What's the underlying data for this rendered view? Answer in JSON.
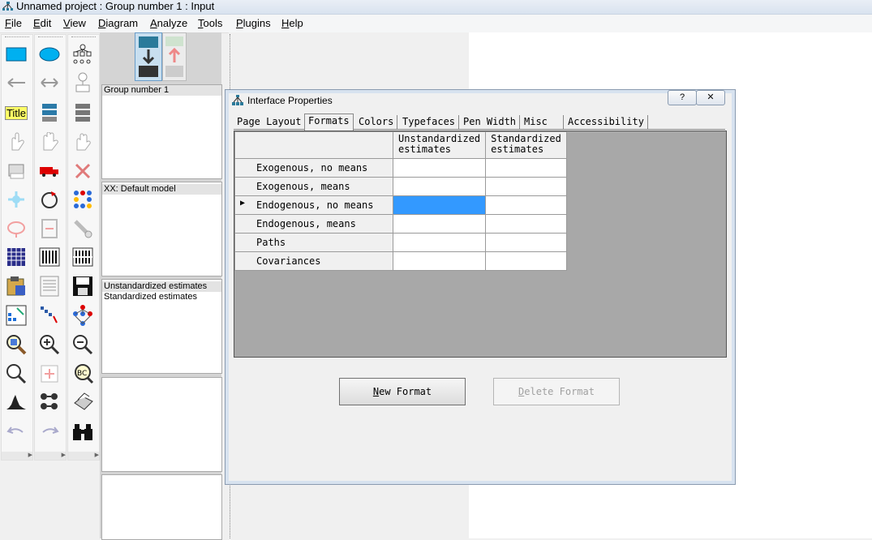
{
  "window": {
    "title": "Unnamed project : Group number 1 : Input"
  },
  "menu": [
    {
      "label": "File",
      "u": "F",
      "rest": "ile"
    },
    {
      "label": "Edit",
      "u": "E",
      "rest": "dit"
    },
    {
      "label": "View",
      "u": "V",
      "rest": "iew"
    },
    {
      "label": "Diagram",
      "u": "D",
      "rest": "iagram"
    },
    {
      "label": "Analyze",
      "u": "A",
      "rest": "nalyze"
    },
    {
      "label": "Tools",
      "u": "T",
      "rest": "ools"
    },
    {
      "label": "Plugins",
      "u": "P",
      "rest": "lugins"
    },
    {
      "label": "Help",
      "u": "H",
      "rest": "elp"
    }
  ],
  "toolbox": {
    "title_tool_label": "Title"
  },
  "panels": {
    "groups": [
      "Group number 1"
    ],
    "models": [
      "XX: Default model"
    ],
    "formats": [
      "Unstandardized estimates",
      "Standardized estimates"
    ]
  },
  "dialog": {
    "title": "Interface Properties",
    "help_button": "?",
    "close_button": "✕",
    "tabs": [
      "Page Layout",
      "Formats",
      "Colors",
      "Typefaces",
      "Pen Width",
      "Misc",
      "Accessibility"
    ],
    "active_tab": "Formats",
    "grid": {
      "columns": [
        "Unstandardized\nestimates",
        "Standardized\nestimates"
      ],
      "rows": [
        "Exogenous, no means",
        "Exogenous, means",
        "Endogenous, no means",
        "Endogenous, means",
        "Paths",
        "Covariances"
      ],
      "current_row": "Endogenous, no means",
      "row_indicator": "▶"
    },
    "buttons": {
      "new_format": {
        "u": "N",
        "rest": "ew Format"
      },
      "delete_format": {
        "u": "D",
        "rest": "elete Format"
      }
    }
  },
  "colors": {
    "selection": "#3399ff",
    "grid_bg": "#a8a8a8"
  }
}
